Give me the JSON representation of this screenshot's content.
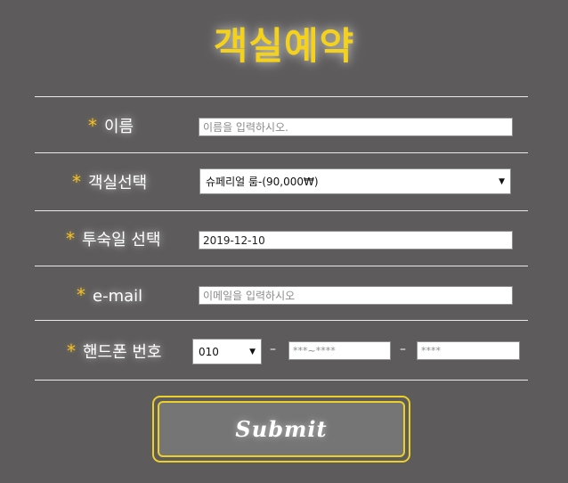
{
  "title": "객실예약",
  "fields": {
    "name": {
      "label": "이름",
      "required_mark": "*",
      "placeholder": "이름을 입력하시오."
    },
    "room": {
      "label": "객실선택",
      "required_mark": "*",
      "selected": "슈페리얼 룸-(90,000₩)"
    },
    "date": {
      "label": "투숙일 선택",
      "required_mark": "*",
      "value": "2019-12-10"
    },
    "email": {
      "label": "e-mail",
      "required_mark": "*",
      "placeholder": "이메일을 입력하시오"
    },
    "phone": {
      "label": "핸드폰 번호",
      "required_mark": "*",
      "prefix_selected": "010",
      "separator": "–",
      "middle_placeholder": "***~****",
      "last_placeholder": "****"
    }
  },
  "submit": {
    "label": "Submit"
  },
  "colors": {
    "background": "#5d5b5c",
    "accent": "#f4d21c",
    "button_fill": "#757575",
    "button_border": "#ecd02a"
  }
}
